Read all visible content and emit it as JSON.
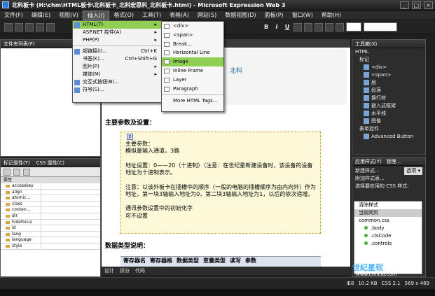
{
  "window": {
    "title": "北科板卡 (H:\\chm\\HTML板卡\\北科板卡_北科宏思科_北科板卡.html) - Microsoft Expression Web 3"
  },
  "menu": [
    "文件(F)",
    "编辑(E)",
    "视图(V)",
    "插入(I)",
    "格式(O)",
    "工具(T)",
    "表格(A)",
    "网站(S)",
    "数据视图(D)",
    "面板(P)",
    "窗口(W)",
    "帮助(H)"
  ],
  "insert_menu": {
    "items": [
      {
        "label": "HTML(T)",
        "shortcut": "▸"
      },
      {
        "label": "ASP.NET 控件(A)",
        "shortcut": "▸"
      },
      {
        "label": "PHP(P)",
        "shortcut": "▸"
      },
      {
        "label": "超链接(I)...",
        "shortcut": "Ctrl+K"
      },
      {
        "label": "书签(K)...",
        "shortcut": "Ctrl+Shift+G"
      },
      {
        "label": "图片(P)",
        "shortcut": "▸"
      },
      {
        "label": "媒体(M)",
        "shortcut": "▸"
      },
      {
        "label": "交互式按钮(B)...",
        "shortcut": ""
      },
      {
        "label": "符号(S)...",
        "shortcut": ""
      }
    ]
  },
  "html_submenu": [
    "<div>",
    "<span>",
    "Break...",
    "Horizontal Line",
    "Image",
    "Inline Frame",
    "Layer",
    "Paragraph",
    "More HTML Tags..."
  ],
  "left_panel": {
    "title": "文件夹列表(F)"
  },
  "tag_props": {
    "title": "标记属性(T)",
    "tab2": "CSS 属性(C)",
    "group": "属性",
    "rows": [
      "accesskey",
      "align",
      "atomic...",
      "class",
      "conten...",
      "dir",
      "hidefocus",
      "id",
      "lang",
      "language",
      "style"
    ]
  },
  "document": {
    "body_title": "北科",
    "heading1": "主要参数及设置：",
    "paragraphs": [
      "主要参数：\n模拟量输入通道，3路",
      "地址设置：0——20（十进制）（注意：在世纪星新建设备时，该设备的设备地址为十进制表示。",
      "注意：以该外板卡在插槽中的顺序（一般的电脑的插槽顺序为由内向外）作为地址，第一块3轴输入地址为0，第二块3轴输入地址为1，以后的依次递增。",
      "通讯参数设置中的初始化字\n可不设置"
    ],
    "ptag": "p",
    "heading2": "数据类型说明：",
    "table_headers": [
      "寄存器名",
      "寄存器格",
      "数据类型",
      "变量类型",
      "读写",
      "参数"
    ]
  },
  "doc_tabs": [
    "设计",
    "拆分",
    "代码"
  ],
  "toolbox": {
    "title": "工具箱(X)",
    "items": [
      "HTML",
      "标记",
      "<div>",
      "<span>",
      "层",
      "段落",
      "换行符",
      "嵌入式框架",
      "水平线",
      "图像",
      "表单控件",
      "Advanced Button"
    ]
  },
  "manage_styles": {
    "title": "应用样式(Y)",
    "tab2": "管理...",
    "new_style": "新建样式...",
    "options": "选项 ▾",
    "attach": "附加样式表...",
    "label": "选择要应用的 CSS 样式:",
    "clear": "清除样式",
    "current": "当前网页",
    "css_file": "common.css",
    "rules": [
      ".body",
      ".clsCode",
      ".controls"
    ]
  },
  "status": {
    "ie": "IE8",
    "size": "10.2 KB",
    "css": "CSS 2.1",
    "dims": "569 x 489"
  },
  "watermark": {
    "line1": "世纪星软",
    "line2": "www.chncia.com"
  }
}
